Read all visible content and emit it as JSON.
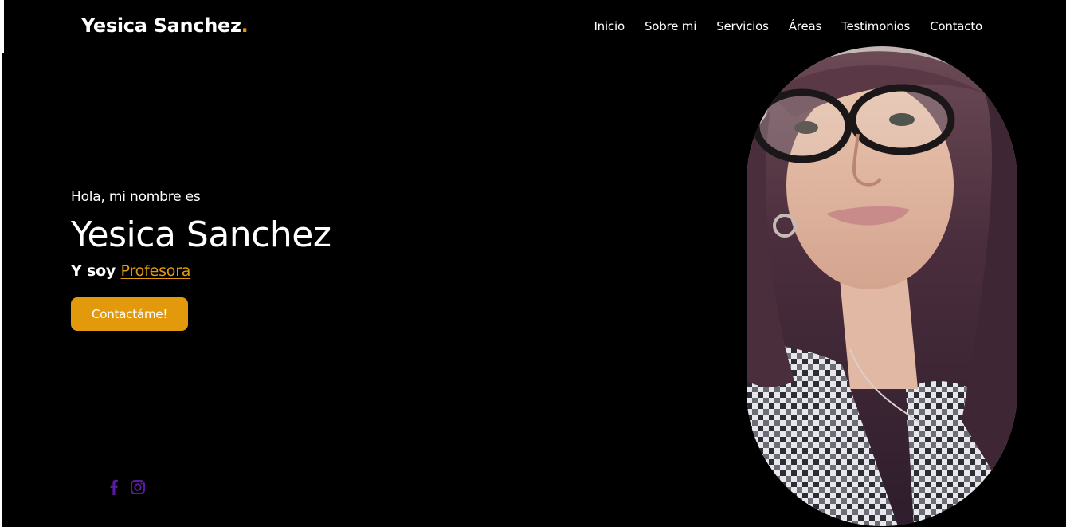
{
  "header": {
    "brand_name": "Yesica Sanchez",
    "brand_dot": "."
  },
  "nav": {
    "items": [
      {
        "label": "Inicio"
      },
      {
        "label": "Sobre mi"
      },
      {
        "label": "Servicios"
      },
      {
        "label": "Áreas"
      },
      {
        "label": "Testimonios"
      },
      {
        "label": "Contacto"
      }
    ]
  },
  "hero": {
    "greeting": "Hola, mi nombre es",
    "name": "Yesica Sanchez",
    "role_prefix": "Y soy ",
    "role_highlight": "Profesora",
    "cta_label": "Contactáme!"
  },
  "social": {
    "icons": [
      "facebook-icon",
      "instagram-icon"
    ]
  },
  "colors": {
    "background": "#000000",
    "accent": "#e29a0c",
    "text": "#ffffff",
    "social": "#5b1aa3"
  }
}
